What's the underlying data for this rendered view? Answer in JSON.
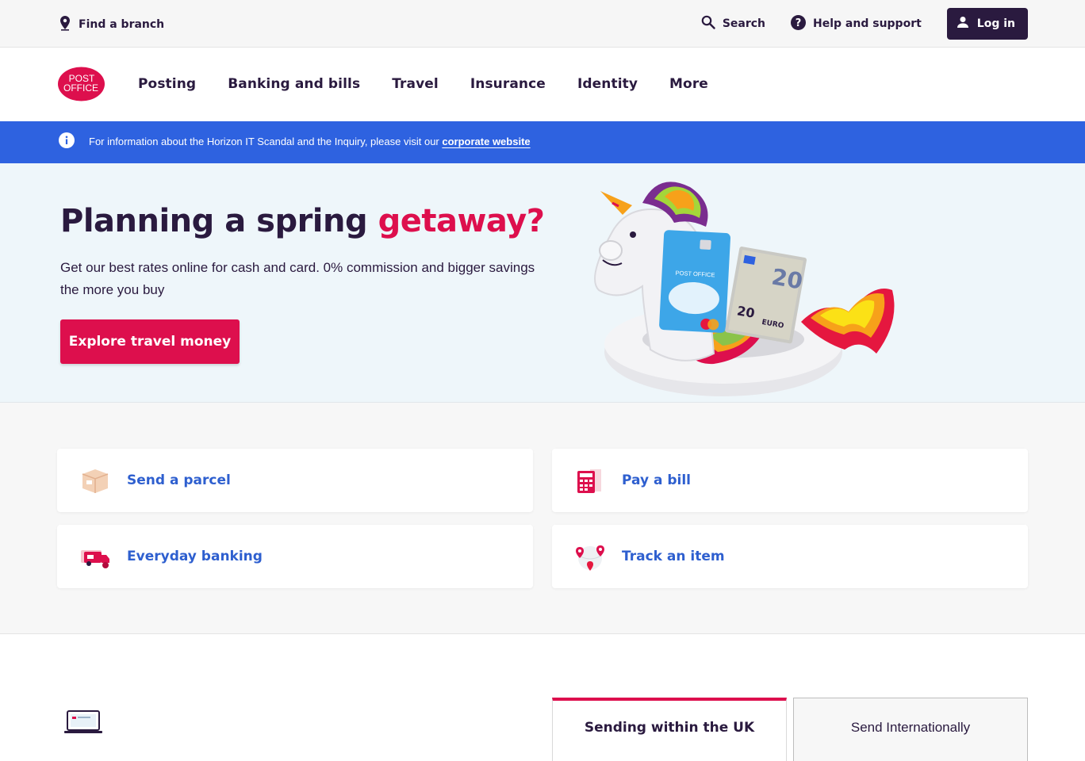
{
  "utility": {
    "find_branch": "Find a branch",
    "search": "Search",
    "help": "Help and support",
    "login": "Log in"
  },
  "logo": {
    "line1": "POST",
    "line2": "OFFICE"
  },
  "nav": {
    "items": [
      "Posting",
      "Banking and bills",
      "Travel",
      "Insurance",
      "Identity",
      "More"
    ]
  },
  "banner": {
    "text": "For information about the Horizon IT Scandal and the Inquiry, please visit our ",
    "link": "corporate website"
  },
  "hero": {
    "title_main": "Planning a spring ",
    "title_accent": "getaway?",
    "body": "Get our best rates online for cash and card. 0% commission and bigger savings the more you buy",
    "cta": "Explore travel money",
    "card_brand": "POST OFFICE",
    "note_value": "20",
    "note_small": "20",
    "note_currency": "EURO"
  },
  "quick_links": [
    {
      "label": "Send a parcel",
      "icon": "parcel-icon"
    },
    {
      "label": "Pay a bill",
      "icon": "calculator-bill-icon"
    },
    {
      "label": "Everyday banking",
      "icon": "banking-van-icon"
    },
    {
      "label": "Track an item",
      "icon": "map-pin-globe-icon"
    }
  ],
  "tabs": {
    "uk": "Sending within the UK",
    "international": "Send Internationally"
  },
  "colors": {
    "brand_red": "#dd0f4d",
    "navy": "#2a1a3f",
    "banner_blue": "#2e62e0",
    "link_blue": "#2e5fcf",
    "hero_bg": "#eef6fa"
  }
}
